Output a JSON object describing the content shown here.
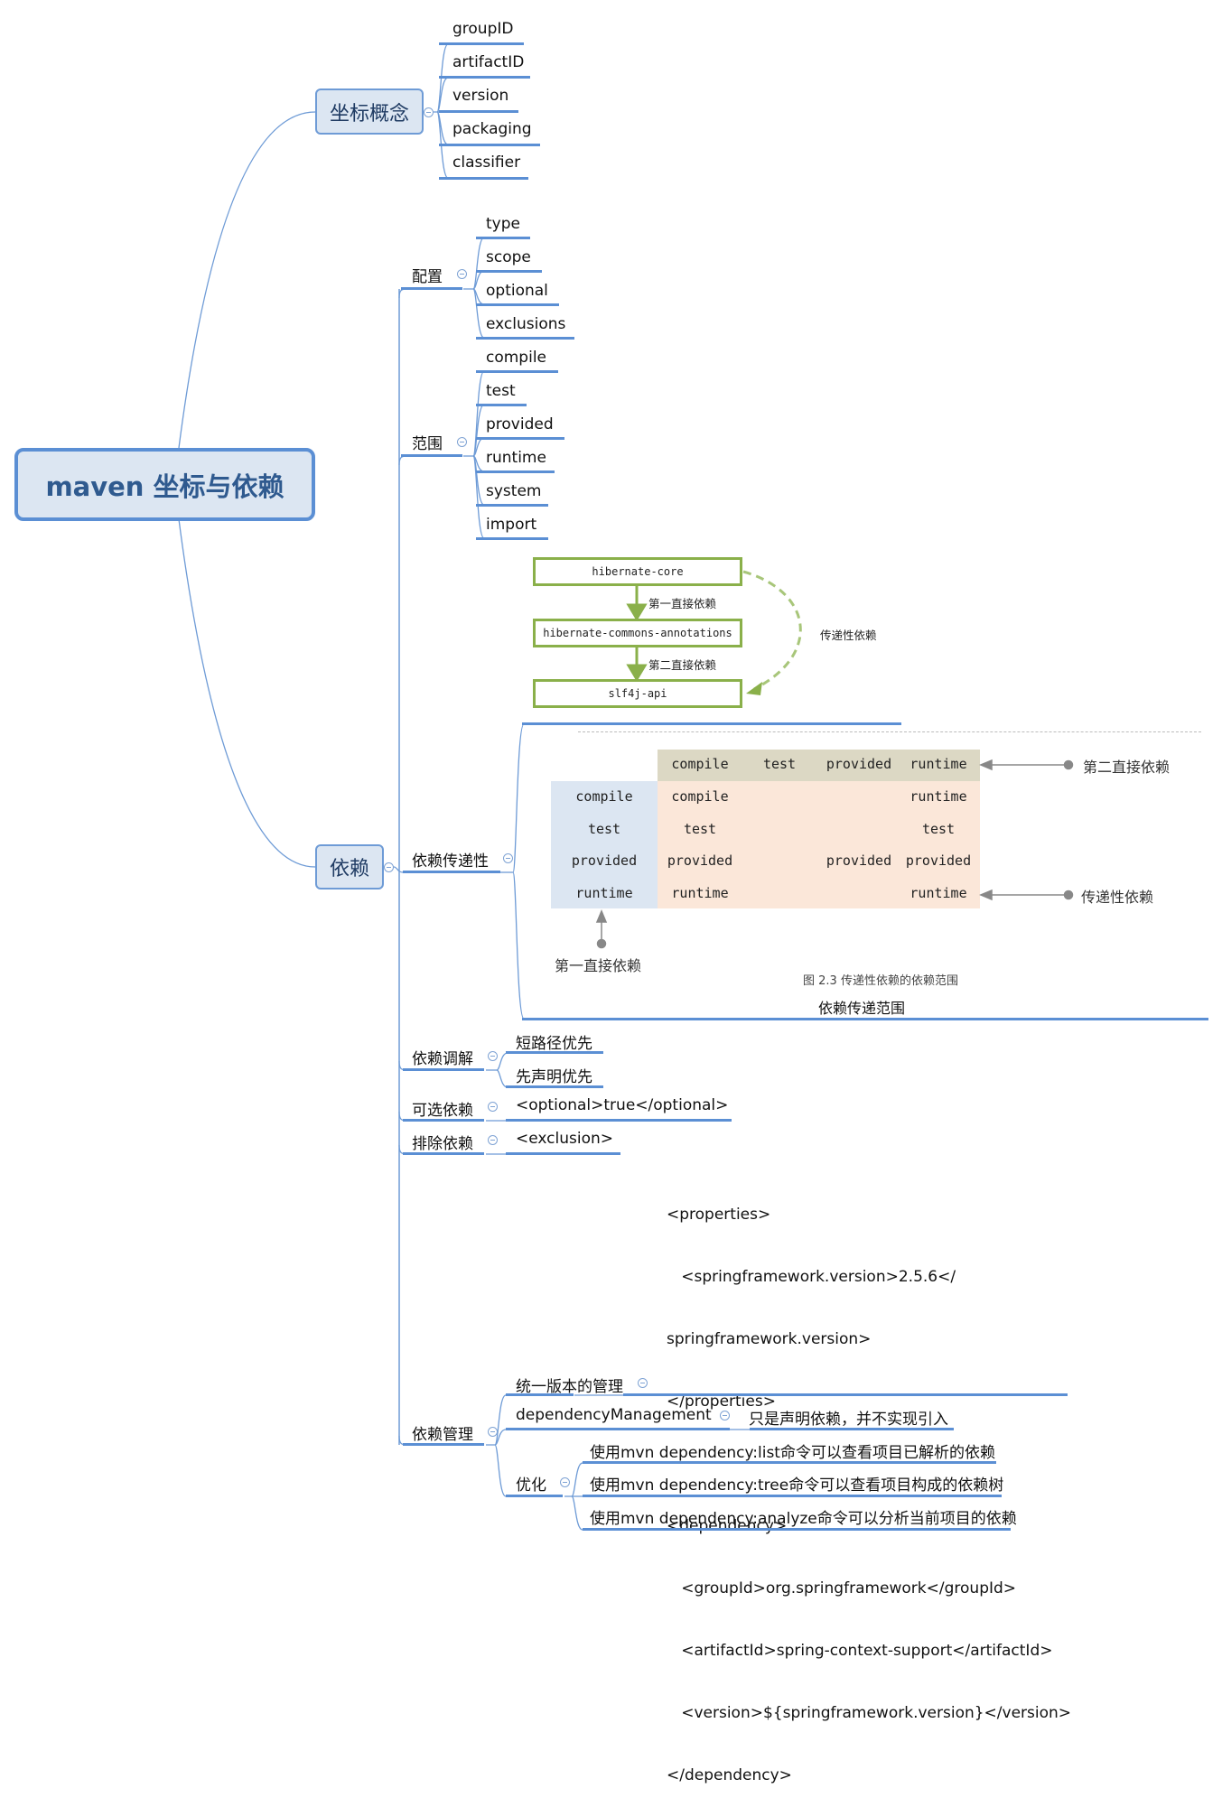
{
  "root": {
    "label": "maven 坐标与依赖"
  },
  "coordinates": {
    "label": "坐标概念",
    "items": [
      "groupID",
      "artifactID",
      "version",
      "packaging",
      "classifier"
    ]
  },
  "dependency": {
    "label": "依赖",
    "config": {
      "label": "配置",
      "items": [
        "type",
        "scope",
        "optional",
        "exclusions"
      ]
    },
    "scope": {
      "label": "范围",
      "items": [
        "compile",
        "test",
        "provided",
        "runtime",
        "system",
        "import"
      ]
    },
    "hibernate_diagram": {
      "boxes": [
        "hibernate-core",
        "hibernate-commons-annotations",
        "slf4j-api"
      ],
      "first_direct": "第一直接依赖",
      "second_direct": "第二直接依赖",
      "transitive": "传递性依赖"
    },
    "transitivity": {
      "label": "依赖传递性",
      "table": {
        "col_headers": [
          "compile",
          "test",
          "provided",
          "runtime"
        ],
        "rows": [
          {
            "header": "compile",
            "cells": [
              "compile",
              "",
              "",
              "runtime"
            ]
          },
          {
            "header": "test",
            "cells": [
              "test",
              "",
              "",
              "test"
            ]
          },
          {
            "header": "provided",
            "cells": [
              "provided",
              "",
              "provided",
              "provided"
            ]
          },
          {
            "header": "runtime",
            "cells": [
              "runtime",
              "",
              "",
              "runtime"
            ]
          }
        ],
        "annotation_second": "第二直接依赖",
        "annotation_transitive": "传递性依赖",
        "annotation_first": "第一直接依赖",
        "figure_caption": "图 2.3 传递性依赖的依赖范围"
      },
      "caption": "依赖传递范围"
    },
    "mediation": {
      "label": "依赖调解",
      "items": [
        "短路径优先",
        "先声明优先"
      ]
    },
    "optional": {
      "label": "可选依赖",
      "value": "<optional>true</optional>"
    },
    "exclusion": {
      "label": "排除依赖",
      "value": "<exclusion>"
    },
    "management": {
      "label": "依赖管理",
      "code_lines": [
        "<properties>",
        "   <springframework.version>2.5.6</",
        "springframework.version>",
        "</properties>",
        "",
        "<dependency>",
        "   <groupId>org.springframework</groupId>",
        "   <artifactId>spring-context-support</artifactId>",
        "   <version>${springframework.version}</version>",
        "</dependency>"
      ],
      "unified_version": "统一版本的管理",
      "dep_mgmt": {
        "label": "dependencyManagement",
        "note": "只是声明依赖，并不实现引入"
      },
      "optimize": {
        "label": "优化",
        "items": [
          "使用mvn dependency:list命令可以查看项目已解析的依赖",
          "使用mvn dependency:tree命令可以查看项目构成的依赖树",
          "使用mvn dependency:analyze命令可以分析当前项目的依赖"
        ]
      }
    }
  },
  "colors": {
    "line": "#5b8fd4",
    "node_fill": "#dce6f2",
    "green": "#8ab04a",
    "table_header": "#dcd8c4",
    "table_row_header": "#dce6f2",
    "table_body": "#fbe7d9"
  }
}
